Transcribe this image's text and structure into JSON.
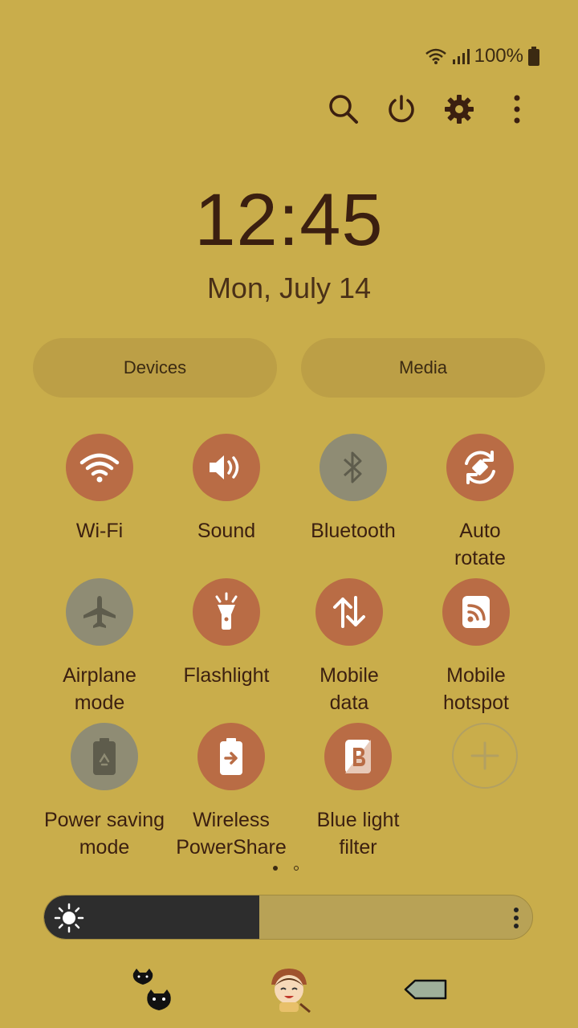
{
  "status": {
    "battery_text": "100%"
  },
  "top_actions": [
    "search-icon",
    "power-icon",
    "settings-icon",
    "more-options-icon"
  ],
  "clock": {
    "time": "12:45",
    "date": "Mon, July 14"
  },
  "pills": {
    "devices": "Devices",
    "media": "Media"
  },
  "tiles": [
    {
      "label": "Wi-Fi",
      "state": "on",
      "icon": "wifi-icon"
    },
    {
      "label": "Sound",
      "state": "on",
      "icon": "sound-icon"
    },
    {
      "label": "Bluetooth",
      "state": "off",
      "icon": "bluetooth-icon"
    },
    {
      "label": "Auto\nrotate",
      "state": "on",
      "icon": "auto-rotate-icon"
    },
    {
      "label": "Airplane\nmode",
      "state": "off",
      "icon": "airplane-icon"
    },
    {
      "label": "Flashlight",
      "state": "on",
      "icon": "flashlight-icon"
    },
    {
      "label": "Mobile\ndata",
      "state": "on",
      "icon": "mobile-data-icon"
    },
    {
      "label": "Mobile\nhotspot",
      "state": "on",
      "icon": "hotspot-icon"
    },
    {
      "label": "Power saving\nmode",
      "state": "off",
      "icon": "power-saving-icon"
    },
    {
      "label": "Wireless\nPowerShare",
      "state": "on",
      "icon": "wireless-powershare-icon"
    },
    {
      "label": "Blue light\nfilter",
      "state": "on",
      "icon": "blue-light-filter-icon"
    },
    {
      "label": "",
      "state": "add",
      "icon": "add-icon"
    }
  ],
  "page_indicator": {
    "current": 1,
    "total": 2
  },
  "brightness": {
    "level": 0.44
  },
  "colors": {
    "background": "#c9ad4b",
    "tile_on": "#b96c45",
    "tile_off": "#8f8c74",
    "text": "#3b1f10"
  }
}
